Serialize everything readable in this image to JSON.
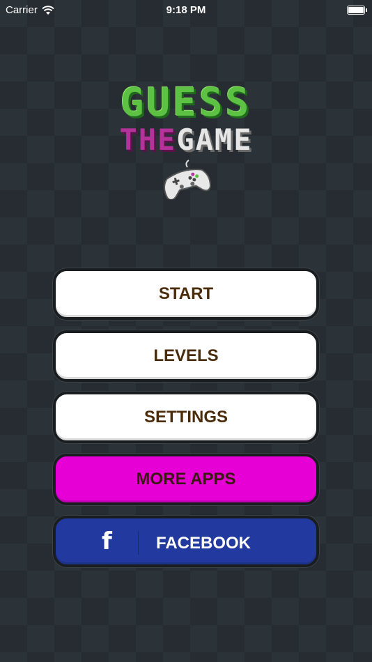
{
  "status_bar": {
    "carrier": "Carrier",
    "time": "9:18 PM"
  },
  "logo": {
    "line1": "GUESS",
    "the": "THE",
    "game": "GAME",
    "icon": "gamepad-icon"
  },
  "menu": {
    "start": "START",
    "levels": "LEVELS",
    "settings": "SETTINGS",
    "more_apps": "MORE APPS",
    "facebook": "FACEBOOK",
    "facebook_icon": "f"
  },
  "colors": {
    "background": "#2c3338",
    "pink": "#e600d6",
    "facebook_blue": "#223aa0",
    "label_brown": "#4a2c0a"
  }
}
